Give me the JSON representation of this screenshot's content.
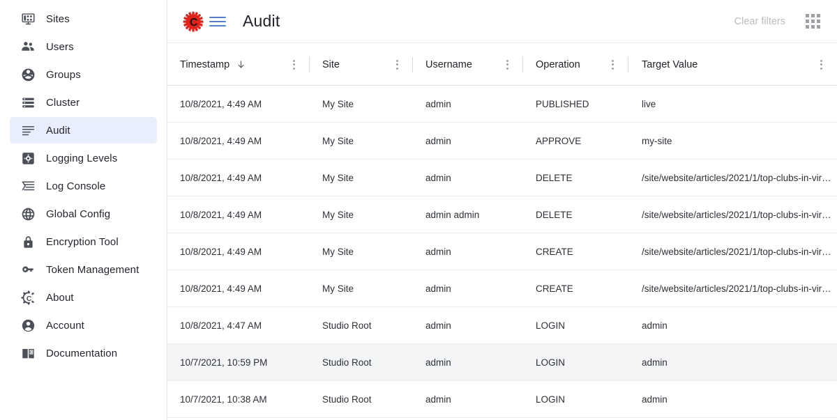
{
  "sidebar": {
    "items": [
      {
        "label": "Sites",
        "icon": "sites-icon",
        "selected": false
      },
      {
        "label": "Users",
        "icon": "users-icon",
        "selected": false
      },
      {
        "label": "Groups",
        "icon": "groups-icon",
        "selected": false
      },
      {
        "label": "Cluster",
        "icon": "cluster-icon",
        "selected": false
      },
      {
        "label": "Audit",
        "icon": "audit-icon",
        "selected": true
      },
      {
        "label": "Logging Levels",
        "icon": "logging-levels-icon",
        "selected": false
      },
      {
        "label": "Log Console",
        "icon": "log-console-icon",
        "selected": false
      },
      {
        "label": "Global Config",
        "icon": "global-config-icon",
        "selected": false
      },
      {
        "label": "Encryption Tool",
        "icon": "encryption-tool-icon",
        "selected": false
      },
      {
        "label": "Token Management",
        "icon": "token-management-icon",
        "selected": false
      },
      {
        "label": "About",
        "icon": "about-icon",
        "selected": false
      },
      {
        "label": "Account",
        "icon": "account-icon",
        "selected": false
      },
      {
        "label": "Documentation",
        "icon": "documentation-icon",
        "selected": false
      }
    ]
  },
  "header": {
    "logo_icon": "crafter-gear-c-logo",
    "logo_color": "#e32119",
    "menu_icon": "hamburger-menu-icon",
    "menu_color": "#4a7fe0",
    "title": "Audit",
    "clear_filters_label": "Clear filters",
    "apps_icon": "apps-grid-icon"
  },
  "table": {
    "columns": [
      {
        "label": "Timestamp",
        "sorted": "desc",
        "sort_icon": "arrow-down-icon"
      },
      {
        "label": "Site",
        "sorted": "",
        "sort_icon": ""
      },
      {
        "label": "Username",
        "sorted": "",
        "sort_icon": ""
      },
      {
        "label": "Operation",
        "sorted": "",
        "sort_icon": ""
      },
      {
        "label": "Target Value",
        "sorted": "",
        "sort_icon": ""
      }
    ],
    "rows": [
      {
        "timestamp": "10/8/2021, 4:49 AM",
        "site": "My Site",
        "username": "admin",
        "operation": "PUBLISHED",
        "target_value": "live",
        "highlight": false
      },
      {
        "timestamp": "10/8/2021, 4:49 AM",
        "site": "My Site",
        "username": "admin",
        "operation": "APPROVE",
        "target_value": "my-site",
        "highlight": false
      },
      {
        "timestamp": "10/8/2021, 4:49 AM",
        "site": "My Site",
        "username": "admin",
        "operation": "DELETE",
        "target_value": "/site/website/articles/2021/1/top-clubs-in-vir…",
        "highlight": false
      },
      {
        "timestamp": "10/8/2021, 4:49 AM",
        "site": "My Site",
        "username": "admin admin",
        "operation": "DELETE",
        "target_value": "/site/website/articles/2021/1/top-clubs-in-vir…",
        "highlight": false
      },
      {
        "timestamp": "10/8/2021, 4:49 AM",
        "site": "My Site",
        "username": "admin",
        "operation": "CREATE",
        "target_value": "/site/website/articles/2021/1/top-clubs-in-vir…",
        "highlight": false
      },
      {
        "timestamp": "10/8/2021, 4:49 AM",
        "site": "My Site",
        "username": "admin",
        "operation": "CREATE",
        "target_value": "/site/website/articles/2021/1/top-clubs-in-vir…",
        "highlight": false
      },
      {
        "timestamp": "10/8/2021, 4:47 AM",
        "site": "Studio Root",
        "username": "admin",
        "operation": "LOGIN",
        "target_value": "admin",
        "highlight": false
      },
      {
        "timestamp": "10/7/2021, 10:59 PM",
        "site": "Studio Root",
        "username": "admin",
        "operation": "LOGIN",
        "target_value": "admin",
        "highlight": true
      },
      {
        "timestamp": "10/7/2021, 10:38 AM",
        "site": "Studio Root",
        "username": "admin",
        "operation": "LOGIN",
        "target_value": "admin",
        "highlight": false
      }
    ]
  }
}
